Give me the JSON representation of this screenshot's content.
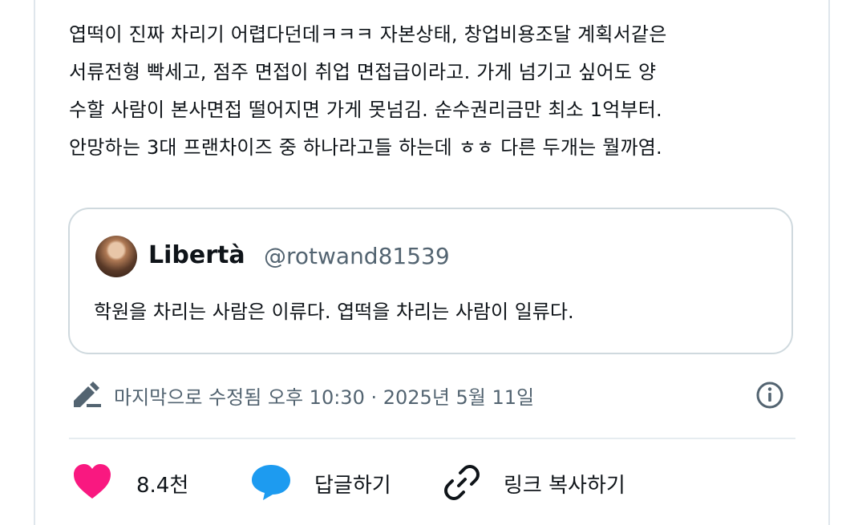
{
  "post": {
    "lines": [
      "엽떡이 진짜 차리기 어렵다던데ㅋㅋㅋ 자본상태, 창업비용조달 계획서같은",
      "서류전형 빡세고, 점주 면접이 취업 면접급이라고. 가게 넘기고 싶어도 양",
      "수할 사람이 본사면접 떨어지면 가게 못넘김. 순수권리금만 최소 1억부터.",
      "안망하는 3대 프랜차이즈 중 하나라고들 하는데 ㅎㅎ 다른 두개는 뭘까염."
    ]
  },
  "quote": {
    "name": "Libertà",
    "handle": "@rotwand81539",
    "text": "학원을 차리는 사람은 이류다. 엽떡을 차리는 사람이 일류다."
  },
  "meta": {
    "edited_text": "마지막으로 수정됨 오후 10:30 · 2025년 5월 11일"
  },
  "actions": {
    "like_count": "8.4천",
    "reply_label": "답글하기",
    "copy_link_label": "링크 복사하기"
  },
  "colors": {
    "like": "#f91880",
    "reply": "#1d9bf0",
    "muted": "#536471",
    "border": "#cfd9de"
  },
  "icons": [
    "pencil-icon",
    "info-icon",
    "heart-icon",
    "speech-bubble-icon",
    "link-icon"
  ]
}
